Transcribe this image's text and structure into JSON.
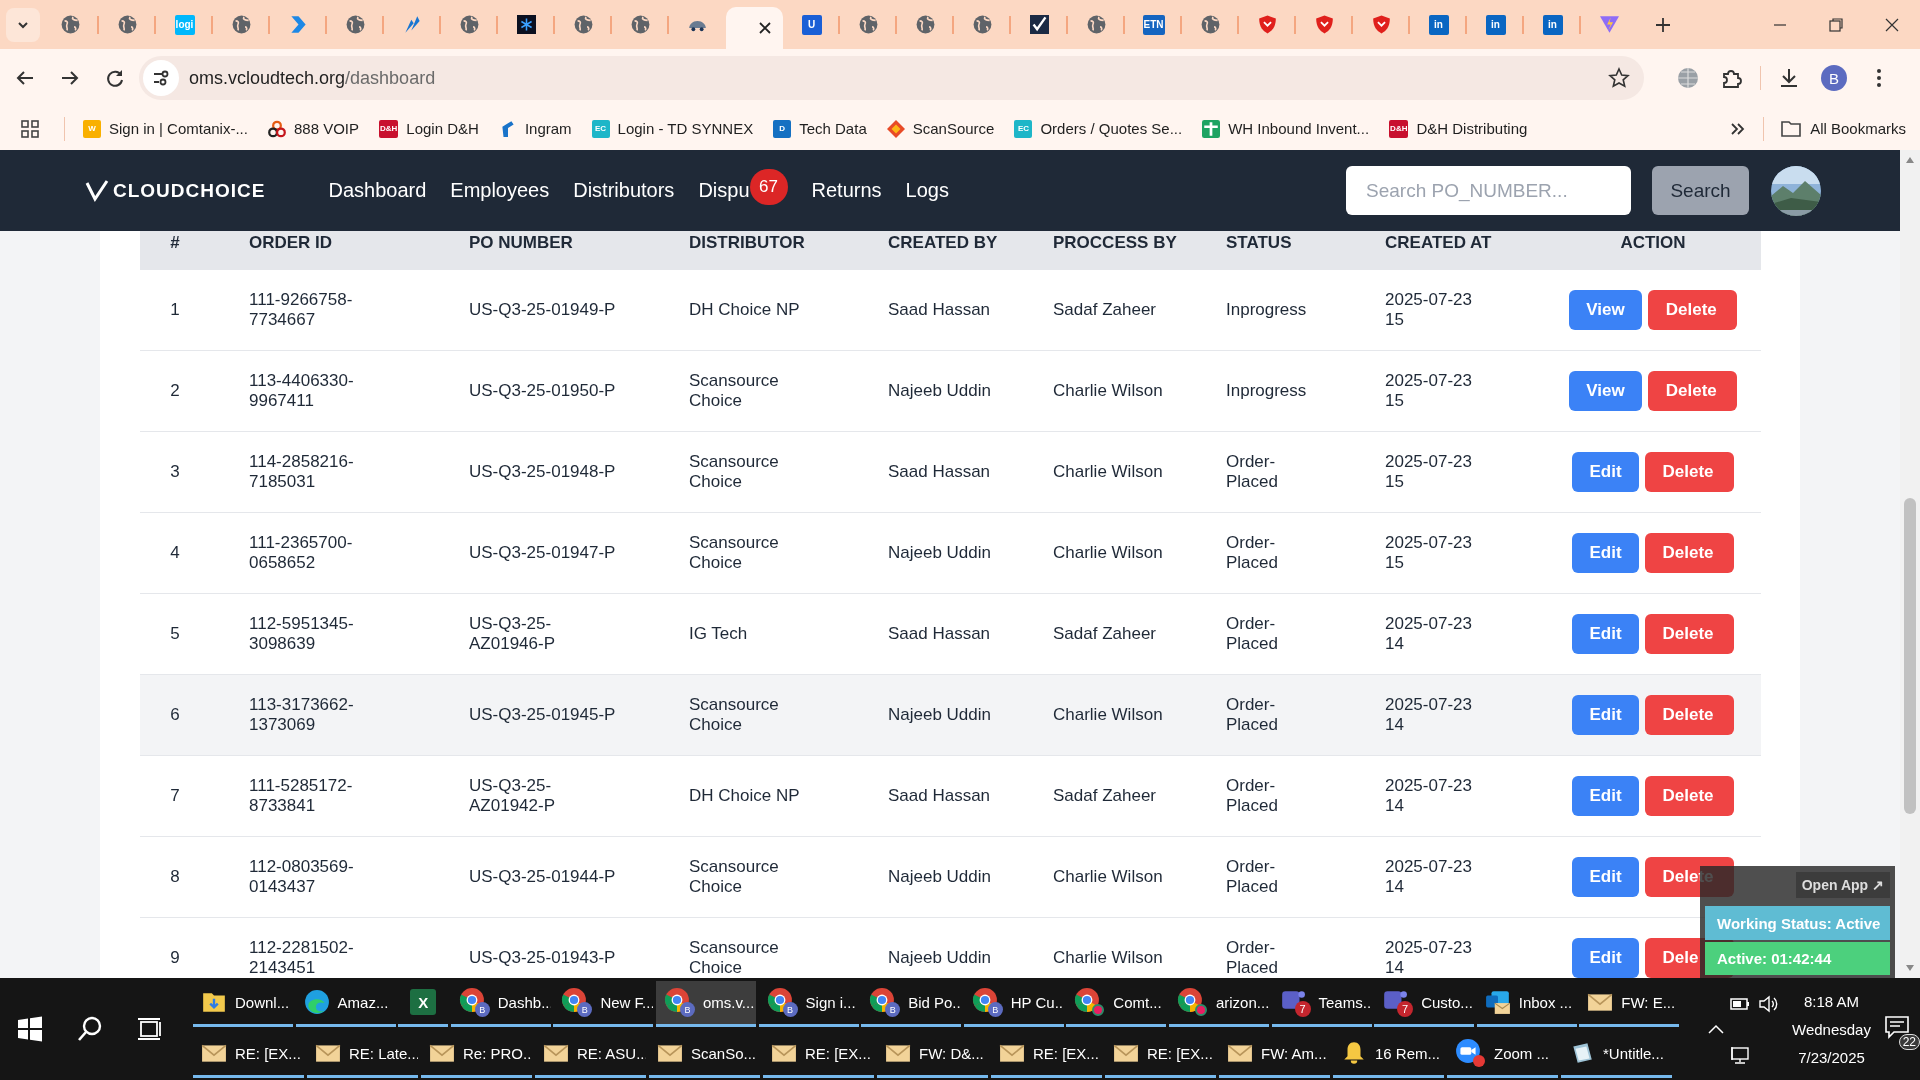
{
  "browser": {
    "tabs": [
      {
        "kind": "globe",
        "selected": false
      },
      {
        "kind": "globe",
        "selected": false
      },
      {
        "kind": "badge",
        "label": "logi",
        "color": "#00b8fc",
        "selected": false
      },
      {
        "kind": "globe",
        "selected": false
      },
      {
        "kind": "arrow",
        "selected": false
      },
      {
        "kind": "globe",
        "selected": false
      },
      {
        "kind": "feather",
        "selected": false
      },
      {
        "kind": "globe",
        "selected": false
      },
      {
        "kind": "snowflake",
        "selected": false
      },
      {
        "kind": "globe",
        "selected": false
      },
      {
        "kind": "globe",
        "selected": false
      },
      {
        "kind": "car",
        "selected": false
      },
      {
        "kind": "blank",
        "selected": true
      },
      {
        "kind": "badge",
        "label": "U",
        "color": "#1a5fd6",
        "selected": false
      },
      {
        "kind": "globe",
        "selected": false
      },
      {
        "kind": "globe",
        "selected": false
      },
      {
        "kind": "globe",
        "selected": false
      },
      {
        "kind": "check",
        "selected": false
      },
      {
        "kind": "globe",
        "selected": false
      },
      {
        "kind": "badge",
        "label": "ETN",
        "color": "#1565c0",
        "selected": false
      },
      {
        "kind": "globe",
        "selected": false
      },
      {
        "kind": "shield",
        "selected": false
      },
      {
        "kind": "shield",
        "selected": false
      },
      {
        "kind": "shield",
        "selected": false
      },
      {
        "kind": "badge",
        "label": "in",
        "color": "#0a66c2",
        "selected": false
      },
      {
        "kind": "badge",
        "label": "in",
        "color": "#0a66c2",
        "selected": false
      },
      {
        "kind": "badge",
        "label": "in",
        "color": "#0a66c2",
        "selected": false
      },
      {
        "kind": "vee",
        "selected": false
      }
    ],
    "address": {
      "host": "oms.vcloudtech.org",
      "path": "/dashboard"
    },
    "profile": "B",
    "bookmarks": [
      {
        "kind": "badge",
        "icon_label": "W",
        "color": "#f9b000",
        "label": "Sign in | Comtanix-..."
      },
      {
        "kind": "rings",
        "label": "888 VOIP"
      },
      {
        "kind": "badge",
        "icon_label": "D&H",
        "color": "#c8102e",
        "label": "Login D&H"
      },
      {
        "kind": "hook",
        "label": "Ingram"
      },
      {
        "kind": "badge",
        "icon_label": "EC",
        "color": "#1eb6c8",
        "label": "Login - TD SYNNEX"
      },
      {
        "kind": "badge",
        "icon_label": "D",
        "color": "#1570c2",
        "label": "Tech Data"
      },
      {
        "kind": "diamond",
        "label": "ScanSource"
      },
      {
        "kind": "badge",
        "icon_label": "EC",
        "color": "#1eb6c8",
        "label": "Orders / Quotes Se..."
      },
      {
        "kind": "sheet",
        "label": "WH Inbound Invent..."
      },
      {
        "kind": "badge",
        "icon_label": "D&H",
        "color": "#c8102e",
        "label": "D&H Distributing"
      }
    ],
    "all_bookmarks": "All Bookmarks"
  },
  "app": {
    "logo": "CLOUDCHOICE",
    "nav": [
      {
        "label": "Dashboard"
      },
      {
        "label": "Employees"
      },
      {
        "label": "Distributors"
      },
      {
        "label": "Dispu",
        "badge": "67"
      },
      {
        "label": "Returns"
      },
      {
        "label": "Logs"
      }
    ],
    "search": {
      "placeholder": "Search PO_NUMBER...",
      "button": "Search"
    }
  },
  "table": {
    "columns": [
      "#",
      "ORDER ID",
      "PO NUMBER",
      "DISTRIBUTOR",
      "CREATED BY",
      "PROCCESS BY",
      "STATUS",
      "CREATED AT",
      "ACTION"
    ],
    "rows": [
      {
        "num": "1",
        "order_id": "111-9266758-7734667",
        "po_number": "US-Q3-25-01949-P",
        "distributor": "DH Choice NP",
        "created_by": "Saad Hassan",
        "processed_by": "Sadaf Zaheer",
        "status": "Inprogress",
        "created_at": "2025-07-23 15",
        "highlighted": false,
        "actions": [
          {
            "kind": "primary",
            "label": "View"
          },
          {
            "kind": "danger",
            "label": "Delete"
          }
        ]
      },
      {
        "num": "2",
        "order_id": "113-4406330-9967411",
        "po_number": "US-Q3-25-01950-P",
        "distributor": "Scansource Choice",
        "created_by": "Najeeb Uddin",
        "processed_by": "Charlie Wilson",
        "status": "Inprogress",
        "created_at": "2025-07-23 15",
        "highlighted": false,
        "actions": [
          {
            "kind": "primary",
            "label": "View"
          },
          {
            "kind": "danger",
            "label": "Delete"
          }
        ]
      },
      {
        "num": "3",
        "order_id": "114-2858216-7185031",
        "po_number": "US-Q3-25-01948-P",
        "distributor": "Scansource Choice",
        "created_by": "Saad Hassan",
        "processed_by": "Charlie Wilson",
        "status": "Order-Placed",
        "created_at": "2025-07-23 15",
        "highlighted": false,
        "actions": [
          {
            "kind": "primary",
            "label": "Edit"
          },
          {
            "kind": "danger",
            "label": "Delete"
          }
        ]
      },
      {
        "num": "4",
        "order_id": "111-2365700-0658652",
        "po_number": "US-Q3-25-01947-P",
        "distributor": "Scansource Choice",
        "created_by": "Najeeb Uddin",
        "processed_by": "Charlie Wilson",
        "status": "Order-Placed",
        "created_at": "2025-07-23 15",
        "highlighted": false,
        "actions": [
          {
            "kind": "primary",
            "label": "Edit"
          },
          {
            "kind": "danger",
            "label": "Delete"
          }
        ]
      },
      {
        "num": "5",
        "order_id": "112-5951345-3098639",
        "po_number": "US-Q3-25-AZ01946-P",
        "distributor": "IG Tech",
        "created_by": "Saad Hassan",
        "processed_by": "Sadaf Zaheer",
        "status": "Order-Placed",
        "created_at": "2025-07-23 14",
        "highlighted": false,
        "actions": [
          {
            "kind": "primary",
            "label": "Edit"
          },
          {
            "kind": "danger",
            "label": "Delete"
          }
        ]
      },
      {
        "num": "6",
        "order_id": "113-3173662-1373069",
        "po_number": "US-Q3-25-01945-P",
        "distributor": "Scansource Choice",
        "created_by": "Najeeb Uddin",
        "processed_by": "Charlie Wilson",
        "status": "Order-Placed",
        "created_at": "2025-07-23 14",
        "highlighted": true,
        "actions": [
          {
            "kind": "primary",
            "label": "Edit"
          },
          {
            "kind": "danger",
            "label": "Delete"
          }
        ]
      },
      {
        "num": "7",
        "order_id": "111-5285172-8733841",
        "po_number": "US-Q3-25-AZ01942-P",
        "distributor": "DH Choice NP",
        "created_by": "Saad Hassan",
        "processed_by": "Sadaf Zaheer",
        "status": "Order-Placed",
        "created_at": "2025-07-23 14",
        "highlighted": false,
        "actions": [
          {
            "kind": "primary",
            "label": "Edit"
          },
          {
            "kind": "danger",
            "label": "Delete"
          }
        ]
      },
      {
        "num": "8",
        "order_id": "112-0803569-0143437",
        "po_number": "US-Q3-25-01944-P",
        "distributor": "Scansource Choice",
        "created_by": "Najeeb Uddin",
        "processed_by": "Charlie Wilson",
        "status": "Order-Placed",
        "created_at": "2025-07-23 14",
        "highlighted": false,
        "actions": [
          {
            "kind": "primary",
            "label": "Edit"
          },
          {
            "kind": "danger",
            "label": "Delete"
          }
        ]
      },
      {
        "num": "9",
        "order_id": "112-2281502-2143451",
        "po_number": "US-Q3-25-01943-P",
        "distributor": "Scansource Choice",
        "created_by": "Najeeb Uddin",
        "processed_by": "Charlie Wilson",
        "status": "Order-Placed",
        "created_at": "2025-07-23 14",
        "highlighted": false,
        "actions": [
          {
            "kind": "primary",
            "label": "Edit"
          },
          {
            "kind": "danger",
            "label": "Dele"
          }
        ]
      }
    ]
  },
  "widget": {
    "button": "Open App ↗",
    "status": "Working Status: Active",
    "timer": "Active: 01:42:44"
  },
  "taskbar": {
    "row1": [
      {
        "kind": "folder",
        "label": "Downl...",
        "active": false
      },
      {
        "kind": "edge",
        "label": "Amaz...",
        "active": false
      },
      {
        "kind": "excel",
        "icon_label": "X",
        "active": false
      },
      {
        "kind": "chrome",
        "badge": "B",
        "label": "Dashb...",
        "active": false
      },
      {
        "kind": "chrome",
        "badge": "B",
        "label": "New F...",
        "active": false
      },
      {
        "kind": "chrome",
        "badge": "B",
        "label": "oms.v...",
        "active": true
      },
      {
        "kind": "chrome",
        "badge": "B",
        "label": "Sign i...",
        "active": false
      },
      {
        "kind": "chrome",
        "badge": "B",
        "label": "Bid Po...",
        "active": false
      },
      {
        "kind": "chrome",
        "badge": "B",
        "label": "HP Cu...",
        "active": false
      },
      {
        "kind": "chrome-dot",
        "label": "Comt...",
        "active": false
      },
      {
        "kind": "chrome-dot",
        "label": "arizon...",
        "active": false
      },
      {
        "kind": "teams",
        "badge": "7",
        "label": "Teams...",
        "active": false
      },
      {
        "kind": "teams",
        "badge": "7",
        "label": "Custo...",
        "active": false
      },
      {
        "kind": "outlook",
        "label": "Inbox ...",
        "active": false
      },
      {
        "kind": "mail",
        "label": "FW: E...",
        "active": false
      }
    ],
    "row2": [
      {
        "kind": "mail",
        "label": "RE: [EX...",
        "active": false
      },
      {
        "kind": "mail",
        "label": "RE: Late...",
        "active": false
      },
      {
        "kind": "mail",
        "label": "Re: PRO...",
        "active": false
      },
      {
        "kind": "mail",
        "label": "RE: ASU...",
        "active": false
      },
      {
        "kind": "mail",
        "label": "ScanSo...",
        "active": false
      },
      {
        "kind": "mail",
        "label": "RE: [EX...",
        "active": false
      },
      {
        "kind": "mail",
        "label": "FW: D&...",
        "active": false
      },
      {
        "kind": "mail",
        "label": "RE: [EX...",
        "active": false
      },
      {
        "kind": "mail",
        "label": "RE: [EX...",
        "active": false
      },
      {
        "kind": "mail",
        "label": "FW: Am...",
        "active": false
      },
      {
        "kind": "bell",
        "label": "16 Rem...",
        "active": false
      },
      {
        "kind": "zoom",
        "label": "Zoom ...",
        "active": false
      },
      {
        "kind": "notepad",
        "label": "*Untitle...",
        "active": false
      }
    ],
    "clock": {
      "time": "8:18 AM",
      "day": "Wednesday",
      "date": "7/23/2025"
    },
    "notifications": "22"
  }
}
